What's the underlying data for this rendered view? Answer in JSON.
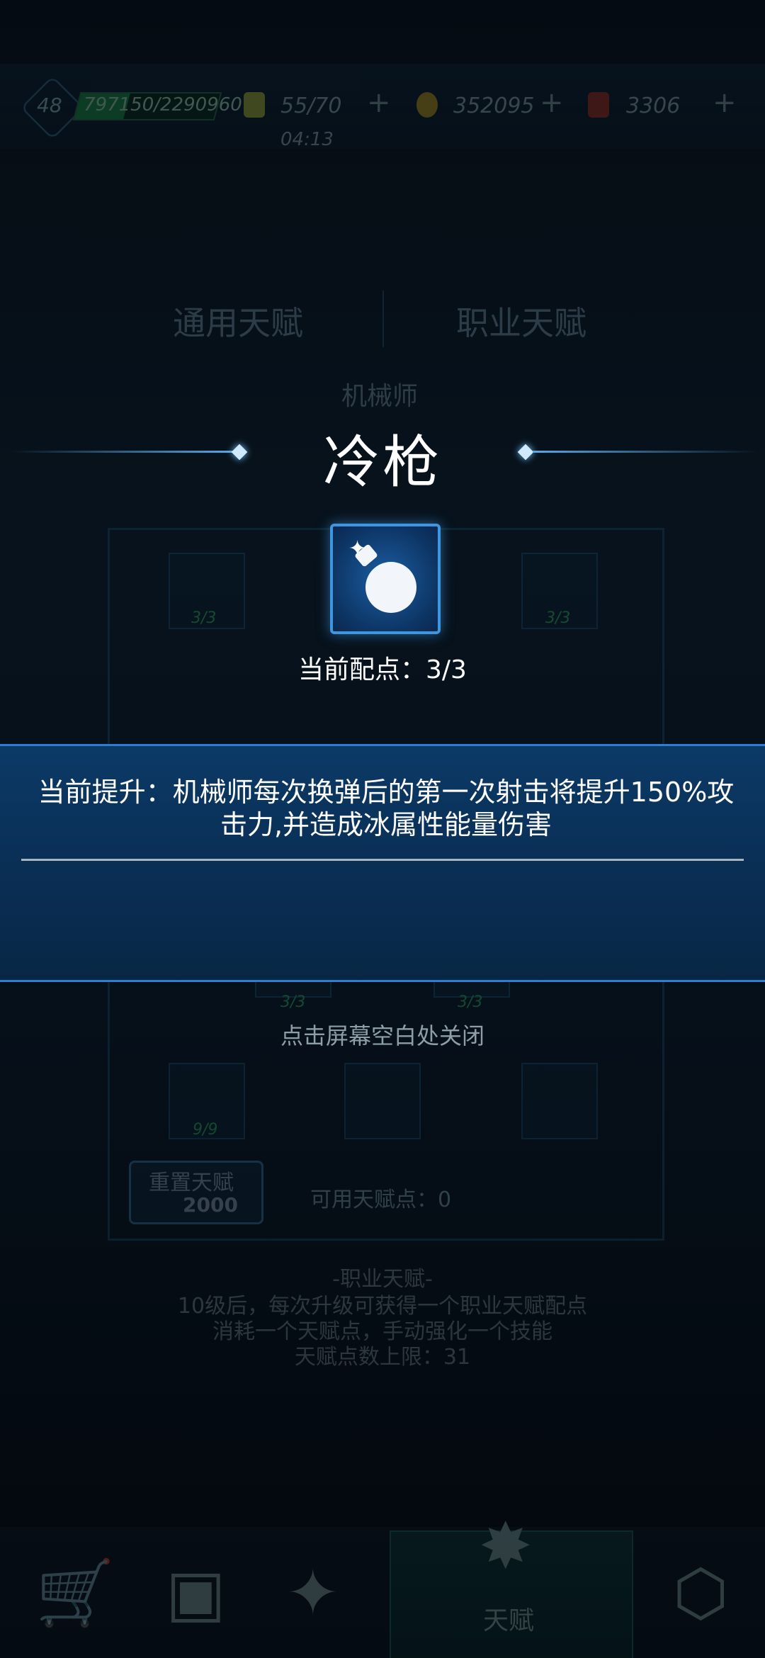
{
  "hud": {
    "level": "48",
    "exp": "797150/2290960",
    "energy": "55/70",
    "energy_timer": "04:13",
    "coins": "352095",
    "crystals": "3306",
    "plus": "+"
  },
  "tabs": [
    "通用天赋",
    "职业天赋"
  ],
  "class_name": "机械师",
  "skills": [
    {
      "count": "3/3",
      "icon": "crosshair-icon"
    },
    {
      "count": "3/3",
      "icon": "reload-icon"
    },
    {
      "count": "3/3",
      "icon": "bullet-icon"
    },
    {
      "count": "3/3",
      "icon": "bomb-icon"
    },
    {
      "count": "9/9",
      "icon": "helmet-icon"
    }
  ],
  "reset": {
    "label": "重置天赋",
    "cost": "2000"
  },
  "available_points": "可用天赋点：0",
  "info": {
    "heading": "-职业天赋-",
    "line1": "10级后，每次升级可获得一个职业天赋配点",
    "line2": "消耗一个天赋点，手动强化一个技能",
    "line3": "天赋点数上限：31"
  },
  "nav": {
    "active_label": "天赋"
  },
  "popup": {
    "title": "冷枪",
    "points": "当前配点：3/3",
    "description": "当前提升：机械师每次换弹后的第一次射击将提升150%攻击力,并造成冰属性能量伤害",
    "close_hint": "点击屏幕空白处关闭",
    "icon": "bomb-icon"
  },
  "colors": {
    "accent": "#3e96e0",
    "band": "#0a3058",
    "green": "#2fbf5a"
  }
}
